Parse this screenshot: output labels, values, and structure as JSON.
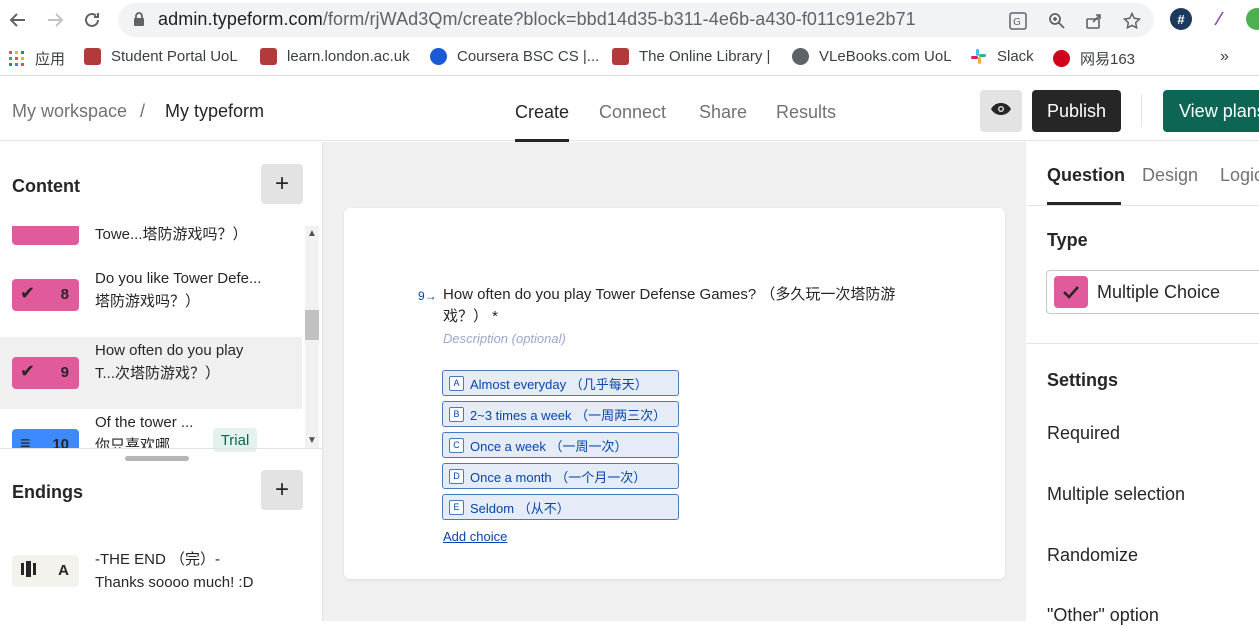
{
  "browser": {
    "url_host": "admin.typeform.com",
    "url_path": "/form/rjWAd3Qm/create?block=bbd14d35-b311-4e6b-a430-f011c91e2b71",
    "bookmarks": [
      {
        "label": "应用",
        "color": "#e0533d"
      },
      {
        "label": "Student Portal UoL",
        "color": "#b23a3a"
      },
      {
        "label": "learn.london.ac.uk",
        "color": "#b23a3a"
      },
      {
        "label": "Coursera BSC CS |...",
        "color": "#1a5ad7"
      },
      {
        "label": "The Online Library |",
        "color": "#b23a3a"
      },
      {
        "label": "VLeBooks.com UoL",
        "color": "#5f6368"
      },
      {
        "label": "Slack",
        "color": "#e01e5a"
      },
      {
        "label": "网易163",
        "color": "#d0021b"
      }
    ],
    "more": "»"
  },
  "header": {
    "workspace": "My workspace",
    "separator": "/",
    "form_name": "My typeform",
    "tabs": [
      "Create",
      "Connect",
      "Share",
      "Results"
    ],
    "publish": "Publish",
    "view_plans": "View plans"
  },
  "left": {
    "content_title": "Content",
    "endings_title": "Endings",
    "add": "+",
    "questions": [
      {
        "num": "",
        "text": "Towe...塔防游戏吗？）",
        "color": "#e05a9c",
        "icon": "✔"
      },
      {
        "num": "8",
        "text": "Do you like Tower Defe...塔防游戏吗？）",
        "color": "#e05a9c",
        "icon": "✔"
      },
      {
        "num": "9",
        "text": "How often do you play T...次塔防游戏？）",
        "color": "#e05a9c",
        "icon": "✔"
      },
      {
        "num": "10",
        "text": "Of the tower ... 你只喜欢哪...",
        "color": "#3d8aff",
        "icon": "≡"
      }
    ],
    "trial": "Trial",
    "ending": {
      "letter": "A",
      "text": "-THE END （完）-Thanks soooo much! :D"
    }
  },
  "question": {
    "number": "9→",
    "title": "How often do you play Tower Defense Games? （多久玩一次塔防游戏？） *",
    "description": "Description (optional)",
    "choices": [
      {
        "key": "A",
        "label": "Almost everyday （几乎每天）"
      },
      {
        "key": "B",
        "label": "2~3 times a week （一周两三次）"
      },
      {
        "key": "C",
        "label": "Once a week （一周一次）"
      },
      {
        "key": "D",
        "label": "Once a month （一个月一次）"
      },
      {
        "key": "E",
        "label": "Seldom （从不）"
      }
    ],
    "add_choice": "Add choice"
  },
  "right": {
    "tabs": [
      "Question",
      "Design",
      "Logic"
    ],
    "type_title": "Type",
    "type_value": "Multiple Choice",
    "settings_title": "Settings",
    "settings": [
      "Required",
      "Multiple selection",
      "Randomize",
      "\"Other\" option"
    ]
  }
}
